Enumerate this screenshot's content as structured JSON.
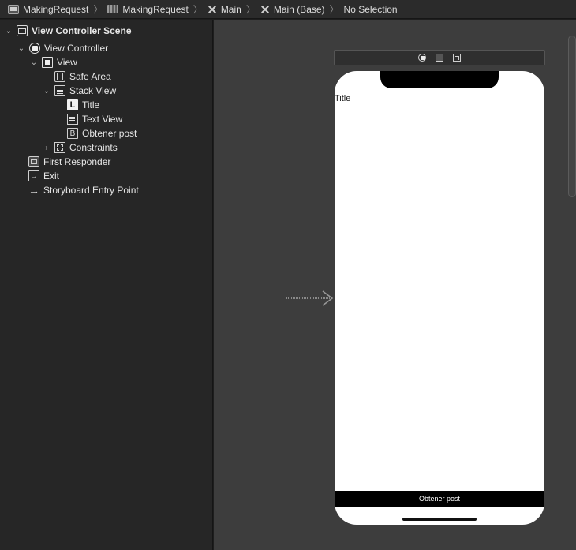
{
  "breadcrumb": [
    {
      "label": "MakingRequest",
      "icon": "project-icon"
    },
    {
      "label": "MakingRequest",
      "icon": "folder-icon"
    },
    {
      "label": "Main",
      "icon": "storyboard-icon"
    },
    {
      "label": "Main (Base)",
      "icon": "storyboard-icon"
    },
    {
      "label": "No Selection",
      "icon": ""
    }
  ],
  "outline": {
    "scene": "View Controller Scene",
    "view_controller": "View Controller",
    "view": "View",
    "safe_area": "Safe Area",
    "stack_view": "Stack View",
    "title": "Title",
    "text_view": "Text View",
    "obtener_post": "Obtener post",
    "constraints": "Constraints",
    "first_responder": "First Responder",
    "exit": "Exit",
    "entry_point": "Storyboard Entry Point",
    "label_glyph": "L",
    "button_glyph": "B"
  },
  "canvas": {
    "title_label": "Title",
    "button_label": "Obtener post"
  },
  "colors": {
    "outline_bg": "#262626",
    "canvas_bg": "#3d3d3d",
    "device_bg": "#ffffff",
    "button_bg": "#000000"
  }
}
